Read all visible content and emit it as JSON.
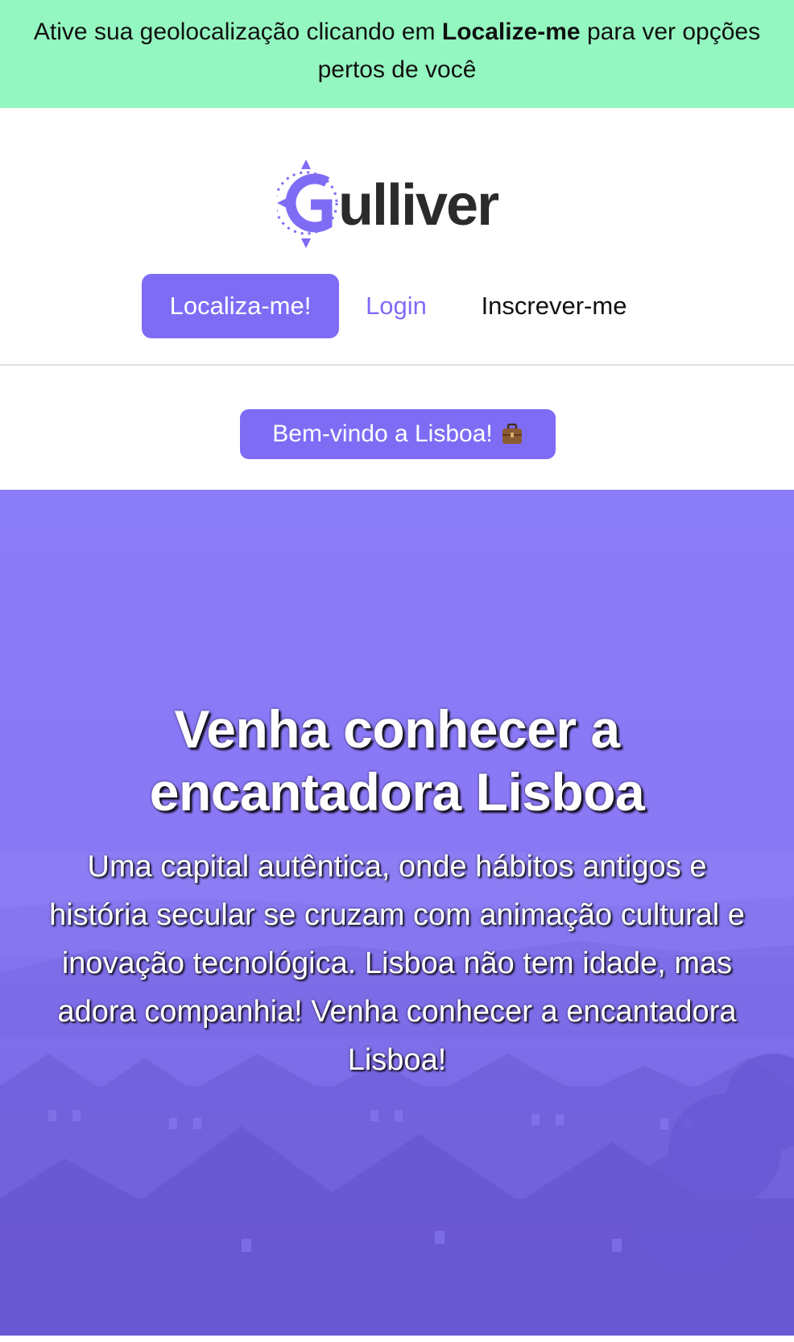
{
  "geo_banner": {
    "text_before": "Ative sua geolocalização clicando em ",
    "text_bold": "Localize-me",
    "text_after": " para ver opções pertos de você"
  },
  "header": {
    "logo_text": "Gulliver",
    "nav": {
      "locate_label": "Localiza-me!",
      "login_label": "Login",
      "signup_label": "Inscrever-me"
    }
  },
  "welcome": {
    "label": "Bem-vindo a Lisboa!",
    "icon": "suitcase-icon"
  },
  "hero": {
    "title": "Venha conhecer a encantadora Lisboa",
    "description": "Uma capital autêntica, onde hábitos antigos e história secular se cruzam com animação cultural e inovação tecnológica. Lisboa não tem idade, mas adora companhia! Venha conhecer a encantadora Lisboa!"
  },
  "colors": {
    "banner_bg": "#94f6c0",
    "brand_purple": "#7f6cf5",
    "hero_overlay": "#8b7cf8",
    "logo_dark": "#2b2b2b"
  }
}
